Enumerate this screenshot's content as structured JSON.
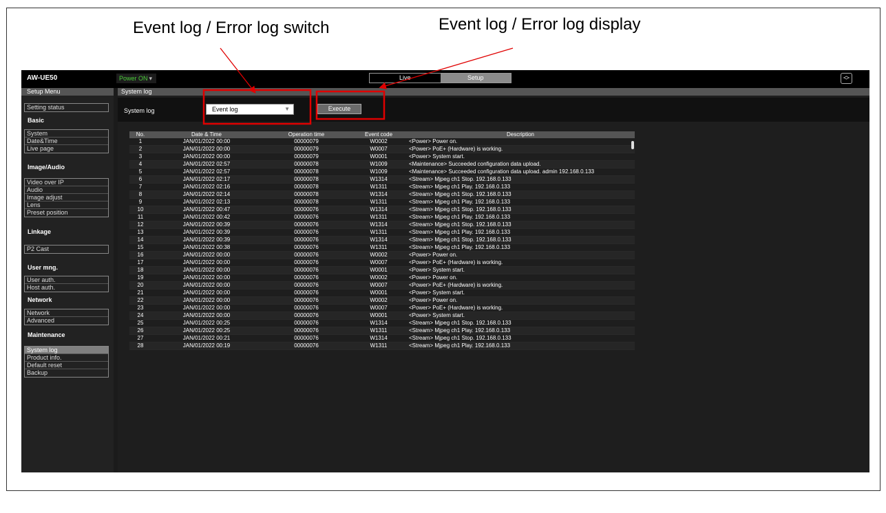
{
  "annotations": {
    "switch_label": "Event log / Error log switch",
    "display_label": "Event log / Error log display",
    "highlight_color": "#e00000"
  },
  "topbar": {
    "model": "AW-UE50",
    "power": "Power ON",
    "power_color": "#4ccf3a",
    "live_label": "Live",
    "setup_label": "Setup",
    "scroll_icon": "up-down-icon"
  },
  "sidebar": {
    "title": "Setup Menu",
    "setting_status": "Setting status",
    "groups": {
      "basic": {
        "title": "Basic",
        "items": [
          "System",
          "Date&Time",
          "Live page"
        ]
      },
      "image_audio": {
        "title": "Image/Audio",
        "items": [
          "Video over IP",
          "Audio",
          "Image adjust",
          "Lens",
          "Preset position"
        ]
      },
      "linkage": {
        "title": "Linkage",
        "items": [
          "P2 Cast"
        ]
      },
      "user_mng": {
        "title": "User mng.",
        "items": [
          "User auth.",
          "Host auth."
        ]
      },
      "network": {
        "title": "Network",
        "items": [
          "Network",
          "Advanced"
        ]
      },
      "maintenance": {
        "title": "Maintenance",
        "items": [
          "System log",
          "Product info.",
          "Default reset",
          "Backup"
        ]
      }
    },
    "active_item": "System log"
  },
  "main": {
    "title": "System log",
    "control_label": "System log",
    "select_value": "Event log",
    "execute_label": "Execute"
  },
  "log_table": {
    "columns": [
      "No.",
      "Date & Time",
      "Operation time",
      "Event code",
      "Description"
    ],
    "rows": [
      [
        "1",
        "JAN/01/2022 00:00",
        "00000079",
        "W0002",
        "<Power> Power on."
      ],
      [
        "2",
        "JAN/01/2022 00:00",
        "00000079",
        "W0007",
        "<Power> PoE+ (Hardware) is working."
      ],
      [
        "3",
        "JAN/01/2022 00:00",
        "00000079",
        "W0001",
        "<Power> System start."
      ],
      [
        "4",
        "JAN/01/2022 02:57",
        "00000078",
        "W1009",
        "<Maintenance> Succeeded configuration data upload."
      ],
      [
        "5",
        "JAN/01/2022 02:57",
        "00000078",
        "W1009",
        "<Maintenance> Succeeded configuration data upload. admin 192.168.0.133"
      ],
      [
        "6",
        "JAN/01/2022 02:17",
        "00000078",
        "W1314",
        "<Stream> Mjpeg ch1 Stop. 192.168.0.133"
      ],
      [
        "7",
        "JAN/01/2022 02:16",
        "00000078",
        "W1311",
        "<Stream> Mjpeg ch1 Play. 192.168.0.133"
      ],
      [
        "8",
        "JAN/01/2022 02:14",
        "00000078",
        "W1314",
        "<Stream> Mjpeg ch1 Stop. 192.168.0.133"
      ],
      [
        "9",
        "JAN/01/2022 02:13",
        "00000078",
        "W1311",
        "<Stream> Mjpeg ch1 Play. 192.168.0.133"
      ],
      [
        "10",
        "JAN/01/2022 00:47",
        "00000076",
        "W1314",
        "<Stream> Mjpeg ch1 Stop. 192.168.0.133"
      ],
      [
        "11",
        "JAN/01/2022 00:42",
        "00000076",
        "W1311",
        "<Stream> Mjpeg ch1 Play. 192.168.0.133"
      ],
      [
        "12",
        "JAN/01/2022 00:39",
        "00000076",
        "W1314",
        "<Stream> Mjpeg ch1 Stop. 192.168.0.133"
      ],
      [
        "13",
        "JAN/01/2022 00:39",
        "00000076",
        "W1311",
        "<Stream> Mjpeg ch1 Play. 192.168.0.133"
      ],
      [
        "14",
        "JAN/01/2022 00:39",
        "00000076",
        "W1314",
        "<Stream> Mjpeg ch1 Stop. 192.168.0.133"
      ],
      [
        "15",
        "JAN/01/2022 00:38",
        "00000076",
        "W1311",
        "<Stream> Mjpeg ch1 Play. 192.168.0.133"
      ],
      [
        "16",
        "JAN/01/2022 00:00",
        "00000076",
        "W0002",
        "<Power> Power on."
      ],
      [
        "17",
        "JAN/01/2022 00:00",
        "00000076",
        "W0007",
        "<Power> PoE+ (Hardware) is working."
      ],
      [
        "18",
        "JAN/01/2022 00:00",
        "00000076",
        "W0001",
        "<Power> System start."
      ],
      [
        "19",
        "JAN/01/2022 00:00",
        "00000076",
        "W0002",
        "<Power> Power on."
      ],
      [
        "20",
        "JAN/01/2022 00:00",
        "00000076",
        "W0007",
        "<Power> PoE+ (Hardware) is working."
      ],
      [
        "21",
        "JAN/01/2022 00:00",
        "00000076",
        "W0001",
        "<Power> System start."
      ],
      [
        "22",
        "JAN/01/2022 00:00",
        "00000076",
        "W0002",
        "<Power> Power on."
      ],
      [
        "23",
        "JAN/01/2022 00:00",
        "00000076",
        "W0007",
        "<Power> PoE+ (Hardware) is working."
      ],
      [
        "24",
        "JAN/01/2022 00:00",
        "00000076",
        "W0001",
        "<Power> System start."
      ],
      [
        "25",
        "JAN/01/2022 00:25",
        "00000076",
        "W1314",
        "<Stream> Mjpeg ch1 Stop. 192.168.0.133"
      ],
      [
        "26",
        "JAN/01/2022 00:25",
        "00000076",
        "W1311",
        "<Stream> Mjpeg ch1 Play. 192.168.0.133"
      ],
      [
        "27",
        "JAN/01/2022 00:21",
        "00000076",
        "W1314",
        "<Stream> Mjpeg ch1 Stop. 192.168.0.133"
      ],
      [
        "28",
        "JAN/01/2022 00:19",
        "00000076",
        "W1311",
        "<Stream> Mjpeg ch1 Play. 192.168.0.133"
      ]
    ]
  }
}
